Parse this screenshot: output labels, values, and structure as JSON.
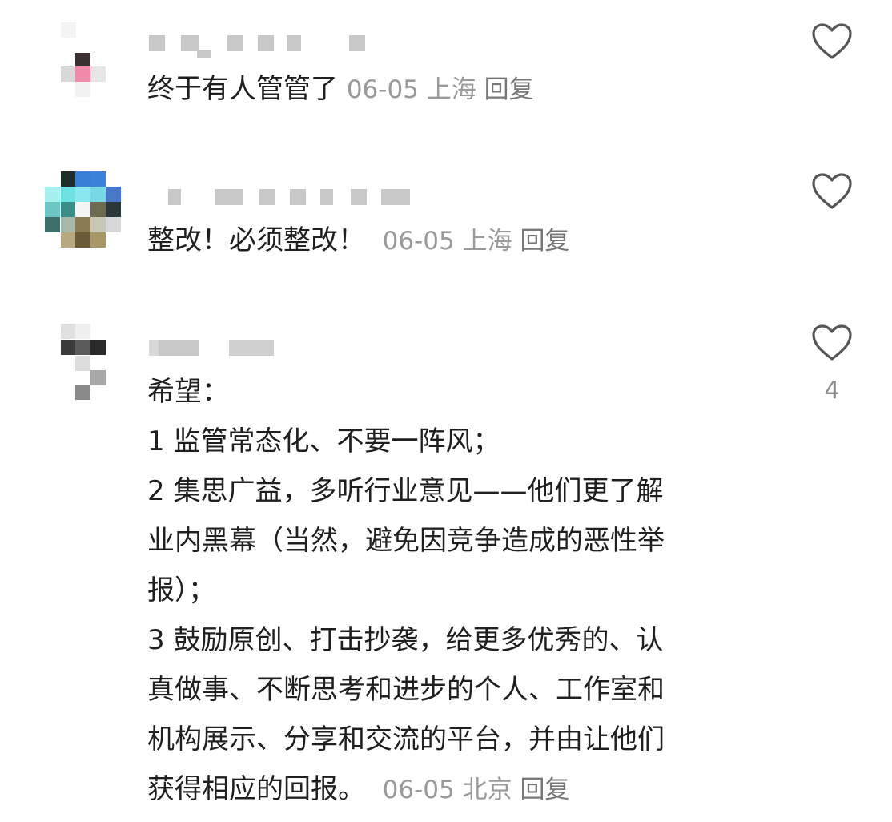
{
  "comments": [
    {
      "text": "终于有人管管了",
      "date": "06-05",
      "location": "上海",
      "reply": "回复",
      "likes": ""
    },
    {
      "text": "整改！必须整改！",
      "date": "06-05",
      "location": "上海",
      "reply": "回复",
      "likes": ""
    },
    {
      "text": "希望：\n1 监管常态化、不要一阵风；\n2 集思广益，多听行业意见——他们更了解\n业内黑幕（当然，避免因竞争造成的恶性举\n报）；\n3 鼓励原创、打击抄袭，给更多优秀的、认\n真做事、不断思考和进步的个人、工作室和\n机构展示、分享和交流的平台，并由让他们\n获得相应的回报。",
      "date": "06-05",
      "location": "北京",
      "reply": "回复",
      "likes": "4"
    }
  ],
  "colors": {
    "text": "#1f1f1f",
    "meta": "#9a9a9a",
    "icon": "#555555",
    "background": "#ffffff"
  },
  "icons": {
    "like": "heart-outline-icon"
  }
}
